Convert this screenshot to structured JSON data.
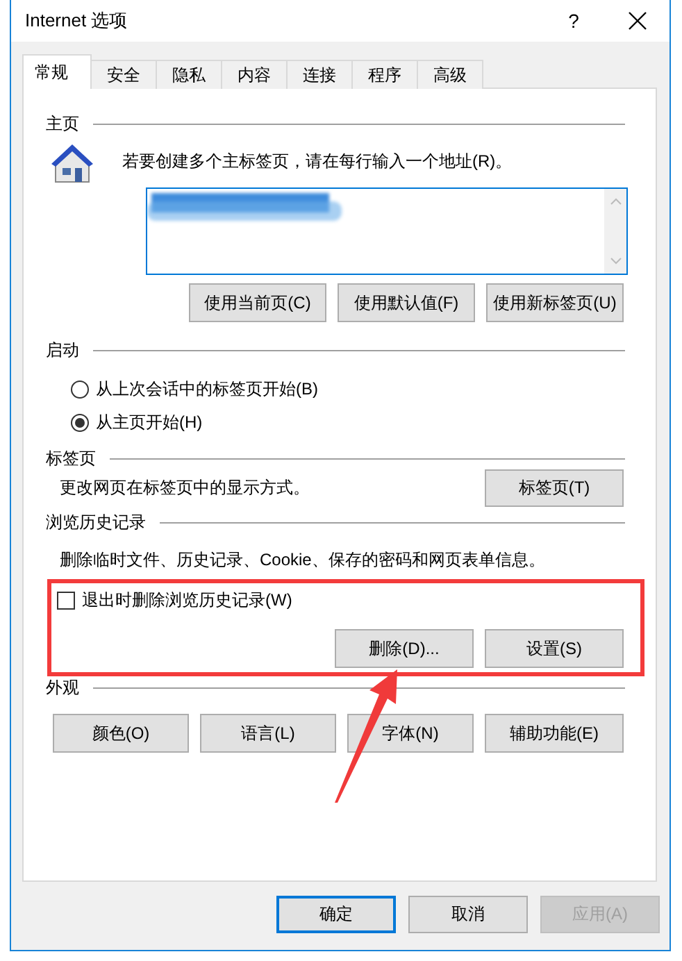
{
  "window": {
    "title": "Internet 选项",
    "help_button": "?"
  },
  "tabs": [
    {
      "label": "常规",
      "selected": true
    },
    {
      "label": "安全",
      "selected": false
    },
    {
      "label": "隐私",
      "selected": false
    },
    {
      "label": "内容",
      "selected": false
    },
    {
      "label": "连接",
      "selected": false
    },
    {
      "label": "程序",
      "selected": false
    },
    {
      "label": "高级",
      "selected": false
    }
  ],
  "home": {
    "heading": "主页",
    "instruction": "若要创建多个主标签页，请在每行输入一个地址(R)。",
    "buttons": [
      "使用当前页(C)",
      "使用默认值(F)",
      "使用新标签页(U)"
    ]
  },
  "startup": {
    "heading": "启动",
    "options": [
      {
        "label": "从上次会话中的标签页开始(B)",
        "selected": false
      },
      {
        "label": "从主页开始(H)",
        "selected": true
      }
    ]
  },
  "tab_settings": {
    "heading": "标签页",
    "description": "更改网页在标签页中的显示方式。",
    "button": "标签页(T)"
  },
  "history": {
    "heading": "浏览历史记录",
    "description": "删除临时文件、历史记录、Cookie、保存的密码和网页表单信息。",
    "delete_on_exit": {
      "label": "退出时删除浏览历史记录(W)",
      "checked": false
    },
    "buttons": [
      "删除(D)...",
      "设置(S)"
    ]
  },
  "appearance": {
    "heading": "外观",
    "buttons": [
      "颜色(O)",
      "语言(L)",
      "字体(N)",
      "辅助功能(E)"
    ]
  },
  "footer_buttons": [
    {
      "label": "确定",
      "default": true,
      "disabled": false
    },
    {
      "label": "取消",
      "default": false,
      "disabled": false
    },
    {
      "label": "应用(A)",
      "default": false,
      "disabled": true
    }
  ]
}
